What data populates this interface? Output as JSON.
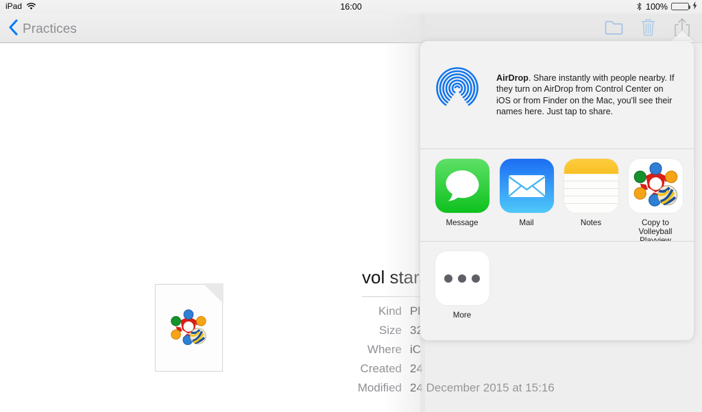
{
  "status_bar": {
    "device_label": "iPad",
    "wifi_icon": "wifi-icon",
    "time": "16:00",
    "bluetooth_icon": "bluetooth-icon",
    "battery_percent": "100%",
    "battery_icon": "battery-charging-icon"
  },
  "nav_bar": {
    "back_label": "Practices",
    "back_icon": "chevron-left-icon",
    "folder_icon": "folder-icon",
    "trash_icon": "trash-icon",
    "share_icon": "share-upload-icon"
  },
  "file_detail": {
    "thumbnail_icon": "document-volleyball-icon",
    "title": "vol stars",
    "rows": [
      {
        "label": "Kind",
        "value": "Pl"
      },
      {
        "label": "Size",
        "value": "32"
      },
      {
        "label": "Where",
        "value": "iC"
      },
      {
        "label": "Created",
        "value": "24"
      },
      {
        "label": "Modified",
        "value": "24 December 2015 at 15:16"
      }
    ]
  },
  "share_sheet": {
    "airdrop": {
      "logo_icon": "airdrop-icon",
      "title": "AirDrop",
      "description": ". Share instantly with people nearby. If they turn on AirDrop from Control Center on iOS or from Finder on the Mac, you'll see their names here. Just tap to share."
    },
    "apps": [
      {
        "label": "Message",
        "icon": "messages-icon"
      },
      {
        "label": "Mail",
        "icon": "mail-icon"
      },
      {
        "label": "Notes",
        "icon": "notes-icon"
      },
      {
        "label": "Copy to Volleyball Playview",
        "icon": "volleyball-playview-icon"
      },
      {
        "label": "",
        "icon": "partial-app-icon"
      }
    ],
    "actions": [
      {
        "label": "More",
        "icon": "more-ellipsis-icon"
      }
    ]
  },
  "colors": {
    "tint_blue": "#007aff",
    "battery_green": "#4cd964",
    "label_gray": "#8e8e93",
    "popover_bg": "#f2f2f2"
  }
}
